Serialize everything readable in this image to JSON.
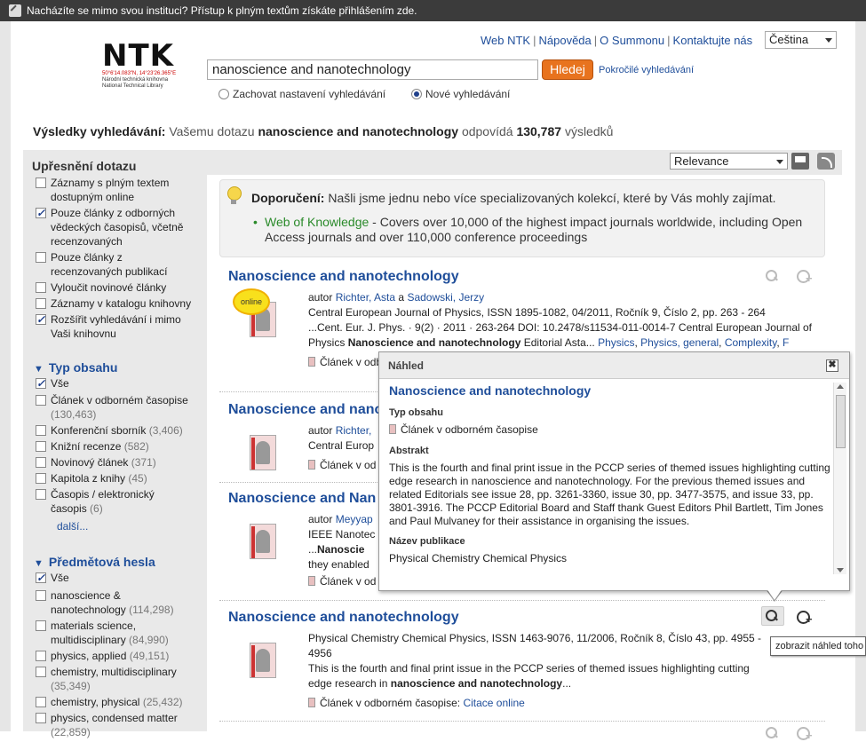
{
  "topbar": {
    "notice": "Nacházíte se mimo svou instituci? Přístup k plným textům získáte přihlášením zde."
  },
  "logo": {
    "name": "NTK",
    "coords": "50°6'14.083\"N, 14°23'26.365\"E",
    "line1": "Národní technická knihovna",
    "line2": "National Technical Library"
  },
  "header": {
    "links": [
      "Web NTK",
      "Nápověda",
      "O Summonu",
      "Kontaktujte nás"
    ],
    "language": "Čeština",
    "search_value": "nanoscience and nanotechnology",
    "search_button": "Hledej",
    "advanced": "Pokročilé vyhledávání",
    "radio_keep": "Zachovat nastavení vyhledávání",
    "radio_new": "Nové vyhledávání"
  },
  "summary": {
    "label": "Výsledky vyhledávání:",
    "pre": "Vašemu dotazu",
    "query": "nanoscience and nanotechnology",
    "mid": "odpovídá",
    "count": "130,787",
    "post": "výsledků"
  },
  "sidebar": {
    "refine_title": "Upřesnění dotazu",
    "refine": [
      {
        "label": "Záznamy s plným textem dostupným online",
        "checked": false
      },
      {
        "label": "Pouze články z odborných vědeckých časopisů, včetně recenzovaných",
        "checked": true
      },
      {
        "label": "Pouze články z recenzovaných publikací",
        "checked": false
      },
      {
        "label": "Vyloučit novinové články",
        "checked": false
      },
      {
        "label": "Záznamy v katalogu knihovny",
        "checked": false
      },
      {
        "label": "Rozšířit vyhledávání i mimo Vaši knihovnu",
        "checked": true
      }
    ],
    "type_title": "Typ obsahu",
    "types": [
      {
        "label": "Vše",
        "count": "",
        "checked": true
      },
      {
        "label": "Článek v odborném časopise",
        "count": "(130,463)",
        "checked": false
      },
      {
        "label": "Konferenční sborník",
        "count": "(3,406)",
        "checked": false
      },
      {
        "label": "Knižní recenze",
        "count": "(582)",
        "checked": false
      },
      {
        "label": "Novinový článek",
        "count": "(371)",
        "checked": false
      },
      {
        "label": "Kapitola z knihy",
        "count": "(45)",
        "checked": false
      },
      {
        "label": "Časopis / elektronický časopis",
        "count": "(6)",
        "checked": false
      }
    ],
    "more": "další...",
    "subject_title": "Předmětová hesla",
    "subjects": [
      {
        "label": "Vše",
        "count": "",
        "checked": true
      },
      {
        "label": "nanoscience & nanotechnology",
        "count": "(114,298)",
        "checked": false
      },
      {
        "label": "materials science, multidisciplinary",
        "count": "(84,990)",
        "checked": false
      },
      {
        "label": "physics, applied",
        "count": "(49,151)",
        "checked": false
      },
      {
        "label": "chemistry, multidisciplinary",
        "count": "(35,349)",
        "checked": false
      },
      {
        "label": "chemistry, physical",
        "count": "(25,432)",
        "checked": false
      },
      {
        "label": "physics, condensed matter",
        "count": "(22,859)",
        "checked": false
      }
    ]
  },
  "toolbar": {
    "sort": "Relevance"
  },
  "recommend": {
    "label": "Doporučení:",
    "text": "Našli jsme jednu nebo více specializovaných kolekcí, které by Vás mohly zajímat.",
    "link": "Web of Knowledge",
    "desc": " - Covers over 10,000 of the highest impact journals worldwide, including Open Access journals and over 110,000 conference proceedings"
  },
  "results": [
    {
      "title": "Nanoscience and nanotechnology",
      "badge": "online",
      "author_label": "autor",
      "authors": [
        "Richter, Asta",
        "Sadowski, Jerzy"
      ],
      "author_join": "a",
      "source": "Central European Journal of Physics, ISSN 1895-1082, 04/2011, Ročník 9, Číslo 2, pp. 263 - 264",
      "snippet_pre": "...Cent. Eur. J. Phys. · 9(2) · 2011 · 263-264 DOI: 10.2478/s11534-011-0014-7 Central European Journal of Physics ",
      "snippet_bold": "Nanoscience and nanotechnology",
      "snippet_post": " Editorial Asta... ",
      "subjects": [
        "Physics",
        "Physics, general",
        "Complexity",
        "F"
      ],
      "type": "Článek v odborném časopise"
    },
    {
      "title": "Nanoscience and nanotechnology",
      "author_label": "autor",
      "author": "Richter,",
      "source": "Central Europ",
      "type": "Článek v od"
    },
    {
      "title": "Nanoscience and Nan",
      "author_label": "autor",
      "author": "Meyyap",
      "source": "IEEE Nanotec",
      "snip_bold": "Nanoscie",
      "snip2": "they enabled",
      "type": "Článek v od"
    },
    {
      "title": "Nanoscience and nanotechnology",
      "source": "Physical Chemistry Chemical Physics, ISSN 1463-9076, 11/2006, Ročník 8, Číslo 43, pp. 4955 - 4956",
      "snippet_pre": "This is the fourth and final print issue in the PCCP series of themed issues highlighting cutting edge research in ",
      "snippet_bold": "nanoscience and nanotechnology",
      "snippet_post": "...",
      "type": "Článek v odborném časopise",
      "link": "Citace online"
    }
  ],
  "preview": {
    "header": "Náhled",
    "close": "✖",
    "title": "Nanoscience and nanotechnology",
    "type_h": "Typ obsahu",
    "type_v": "Článek v odborném časopise",
    "abstract_h": "Abstrakt",
    "abstract_v": "This is the fourth and final print issue in the PCCP series of themed issues highlighting cutting edge research in nanoscience and nanotechnology. For the previous themed issues and related Editorials see issue 28, pp. 3261-3360, issue 30, pp. 3477-3575, and issue 33, pp. 3801-3916. The PCCP Editorial Board and Staff thank Guest Editors Phil Bartlett, Tim Jones and Paul Mulvaney for their assistance in organising the issues.",
    "pub_h": "Název publikace",
    "pub_v": "Physical Chemistry Chemical Physics"
  },
  "tooltip": "zobrazit náhled toho"
}
